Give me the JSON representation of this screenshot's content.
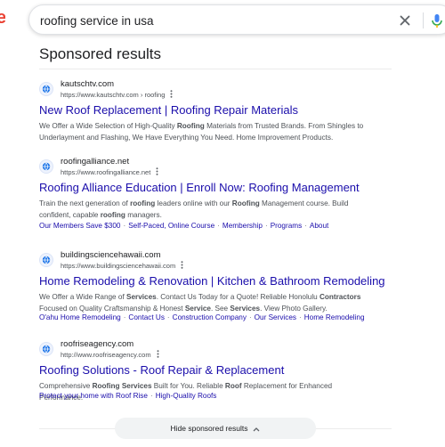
{
  "search": {
    "query": "roofing service in usa"
  },
  "logo_fragment": "e",
  "section_title": "Sponsored results",
  "colors": {
    "link": "#1a0dab",
    "text_secondary": "#4d5156",
    "logo_red": "#ea4335",
    "mic_blue": "#4285f4"
  },
  "icons": {
    "clear": "close-icon",
    "mic": "microphone-icon",
    "favicon": "globe-icon",
    "menu": "vertical-dots-icon",
    "collapse": "chevron-up-icon"
  },
  "ads": [
    {
      "site": "kautschtv.com",
      "url": "https://www.kautschtv.com › roofing",
      "title": "New Roof Replacement | Roofing Repair Materials",
      "desc_line1": [
        "We Offer a Wide Selection of High-Quality ",
        "Roofing",
        " Materials from Trusted Brands. From Shingles to"
      ],
      "desc_line2": "Underlayment and Flashing, We Have Everything You Need. Home Improvement Products.",
      "sitelinks": []
    },
    {
      "site": "roofingalliance.net",
      "url": "https://www.roofingalliance.net",
      "title": "Roofing Alliance Education | Enroll Now: Roofing Management",
      "desc_line1": [
        "Train the next generation of ",
        "roofing",
        " leaders online with our ",
        "Roofing",
        " Management course. Build"
      ],
      "desc_line2": [
        "confident, capable ",
        "roofing",
        " managers."
      ],
      "sitelinks": [
        "Our Members Save $300",
        "Self-Paced, Online Course",
        "Membership",
        "Programs",
        "About"
      ]
    },
    {
      "site": "buildingsciencehawaii.com",
      "url": "https://www.buildingsciencehawaii.com",
      "title": "Home Remodeling & Renovation | Kitchen & Bathroom Remodeling",
      "desc_line1": [
        "We Offer a Wide Range of ",
        "Services",
        ". Contact Us Today for a Quote! Reliable Honolulu ",
        "Contractors"
      ],
      "desc_line2": [
        "Focused on Quality Craftsmanship & Honest ",
        "Service",
        ". See ",
        "Services",
        ". View Photo Gallery."
      ],
      "sitelinks": [
        "O'ahu Home Remodeling",
        "Contact Us",
        "Construction Company",
        "Our Services",
        "Home Remodeling"
      ]
    },
    {
      "site": "roofriseagency.com",
      "url": "http://www.roofriseagency.com",
      "title": "Roofing Solutions - Roof Repair & Replacement",
      "desc_line1": [
        "Comprehensive ",
        "Roofing Services",
        " Built for You. Reliable ",
        "Roof",
        " Replacement for Enhanced Performance."
      ],
      "sitelinks": [
        "Protect your home with Roof Rise",
        "High-Quality Roofs"
      ]
    }
  ],
  "hide_button_label": "Hide sponsored results"
}
